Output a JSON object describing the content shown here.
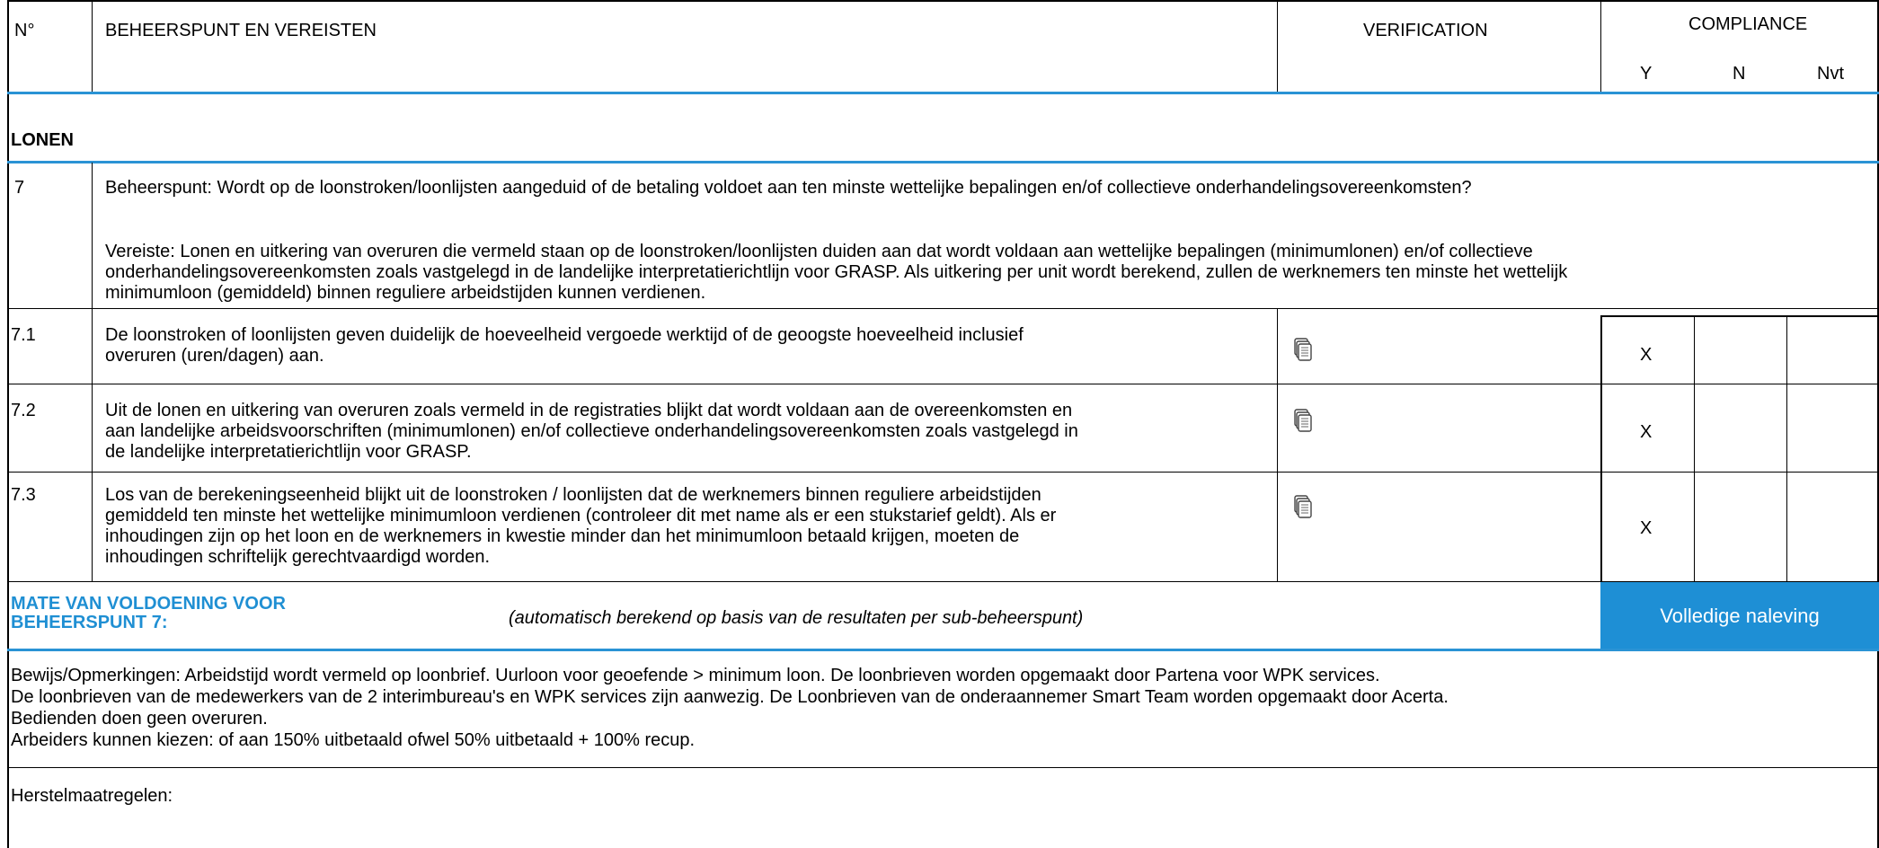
{
  "header": {
    "col_num": "N°",
    "col_req": "BEHEERSPUNT EN VEREISTEN",
    "col_verif": "VERIFICATION",
    "col_comp": "COMPLIANCE",
    "comp_y": "Y",
    "comp_n": "N",
    "comp_nvt": "Nvt"
  },
  "section": {
    "title": "LONEN"
  },
  "control": {
    "number": "7",
    "question": "Beheerspunt: Wordt op de loonstroken/loonlijsten aangeduid of de betaling voldoet aan ten minste wettelijke bepalingen en/of collectieve onderhandelingsovereenkomsten?",
    "requirement_lines": [
      "Vereiste: Lonen en uitkering van overuren die vermeld staan op de loonstroken/loonlijsten duiden aan dat wordt voldaan aan wettelijke bepalingen (minimumlonen) en/of collectieve",
      "onderhandelingsovereenkomsten zoals vastgelegd in de landelijke interpretatierichtlijn voor GRASP. Als uitkering per unit wordt berekend, zullen de werknemers ten minste het wettelijk",
      "minimumloon (gemiddeld) binnen reguliere arbeidstijden kunnen verdienen."
    ]
  },
  "subpoints": [
    {
      "number": "7.1",
      "lines": [
        "De loonstroken of loonlijsten geven duidelijk de hoeveelheid vergoede werktijd of de geoogste hoeveelheid inclusief",
        "overuren (uren/dagen) aan."
      ],
      "verification_icon": "document-stack-icon",
      "y": "X",
      "n": "",
      "nvt": ""
    },
    {
      "number": "7.2",
      "lines": [
        "Uit de lonen en uitkering van overuren zoals vermeld in de registraties blijkt dat wordt voldaan aan de overeenkomsten en",
        "aan landelijke arbeidsvoorschriften (minimumlonen) en/of collectieve onderhandelingsovereenkomsten zoals vastgelegd in",
        "de landelijke interpretatierichtlijn voor GRASP."
      ],
      "verification_icon": "document-stack-icon",
      "y": "X",
      "n": "",
      "nvt": ""
    },
    {
      "number": "7.3",
      "lines": [
        "Los van de berekeningseenheid blijkt uit de loonstroken / loonlijsten dat de werknemers binnen reguliere arbeidstijden",
        "gemiddeld ten minste het wettelijke minimumloon verdienen (controleer dit met name als er een stukstarief geldt). Als er",
        "inhoudingen zijn op het loon en de werknemers in kwestie minder dan het minimumloon betaald krijgen, moeten de",
        "inhoudingen schriftelijk gerechtvaardigd worden."
      ],
      "verification_icon": "document-stack-icon",
      "y": "X",
      "n": "",
      "nvt": ""
    }
  ],
  "summary": {
    "label_line1": "MATE VAN VOLDOENING VOOR",
    "label_line2": "BEHEERSPUNT 7:",
    "note": "(automatisch berekend op basis van de resultaten per sub-beheerspunt)",
    "result": "Volledige naleving",
    "result_color": "#1e8fd5"
  },
  "remarks": {
    "lines": [
      "Bewijs/Opmerkingen: Arbeidstijd wordt vermeld op loonbrief. Uurloon voor geoefende > minimum loon. De loonbrieven worden opgemaakt door Partena voor WPK services.",
      "De loonbrieven van de medewerkers van de 2 interimbureau's en WPK services zijn aanwezig. De Loonbrieven van de onderaannemer Smart Team worden opgemaakt door Acerta.",
      "Bedienden doen geen overuren.",
      "Arbeiders kunnen kiezen: of aan 150% uitbetaald ofwel 50% uitbetaald + 100% recup."
    ]
  },
  "corrective": {
    "label": "Herstelmaatregelen:"
  },
  "colors": {
    "accent_blue": "#2a93d5",
    "heading_blue": "#1f8fd3"
  }
}
